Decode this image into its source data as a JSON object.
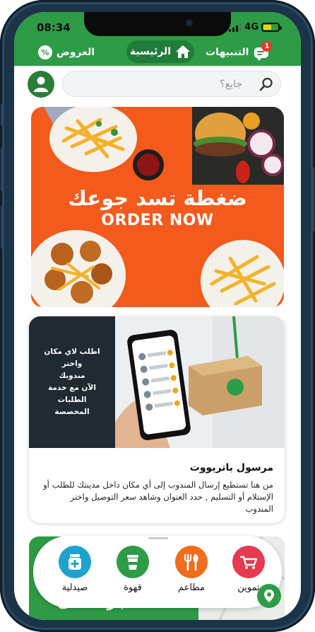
{
  "status_bar": {
    "time": "08:34",
    "network": "4G"
  },
  "header": {
    "offers_label": "العروض",
    "offers_icon": "percent-icon",
    "home_label": "الرئيسية",
    "home_icon": "home-icon",
    "notifications_label": "التنبيهات",
    "notifications_icon": "chat-bubble-icon",
    "notifications_count": "1"
  },
  "search": {
    "placeholder": "جايع؟"
  },
  "banner_food": {
    "headline_ar": "ضغطة تسد جوعك",
    "headline_en": "ORDER NOW"
  },
  "courier_card": {
    "overlay_line1": "اطلب لاي مكان واختر",
    "overlay_line2": "مندوبك",
    "overlay_line3": "الآن مع خدمة الطلبات",
    "overlay_line4": "المخصصة",
    "title": "مرسول باتريووت",
    "description": "من هنا تستطيع إرسال المندوب إلى أي مكان داخل مدينتك للطلب أو الإستلام أو التسليم , حدد العنوان وشاهد سعر التوصيل واختر المندوب"
  },
  "bottom_banner": {
    "text": "أضف متجرك الآن"
  },
  "categories": [
    {
      "label": "تموين",
      "icon": "basket-icon",
      "color": "#e53a4f"
    },
    {
      "label": "مطاعم",
      "icon": "fork-spoon-icon",
      "color": "#f06d1d"
    },
    {
      "label": "قهوة",
      "icon": "coffee-cup-icon",
      "color": "#2e9b47"
    },
    {
      "label": "صيدلية",
      "icon": "pharmacy-icon",
      "color": "#1fa3cc"
    }
  ],
  "colors": {
    "brand_green": "#2e9b47",
    "banner_orange": "#f35a1c"
  }
}
